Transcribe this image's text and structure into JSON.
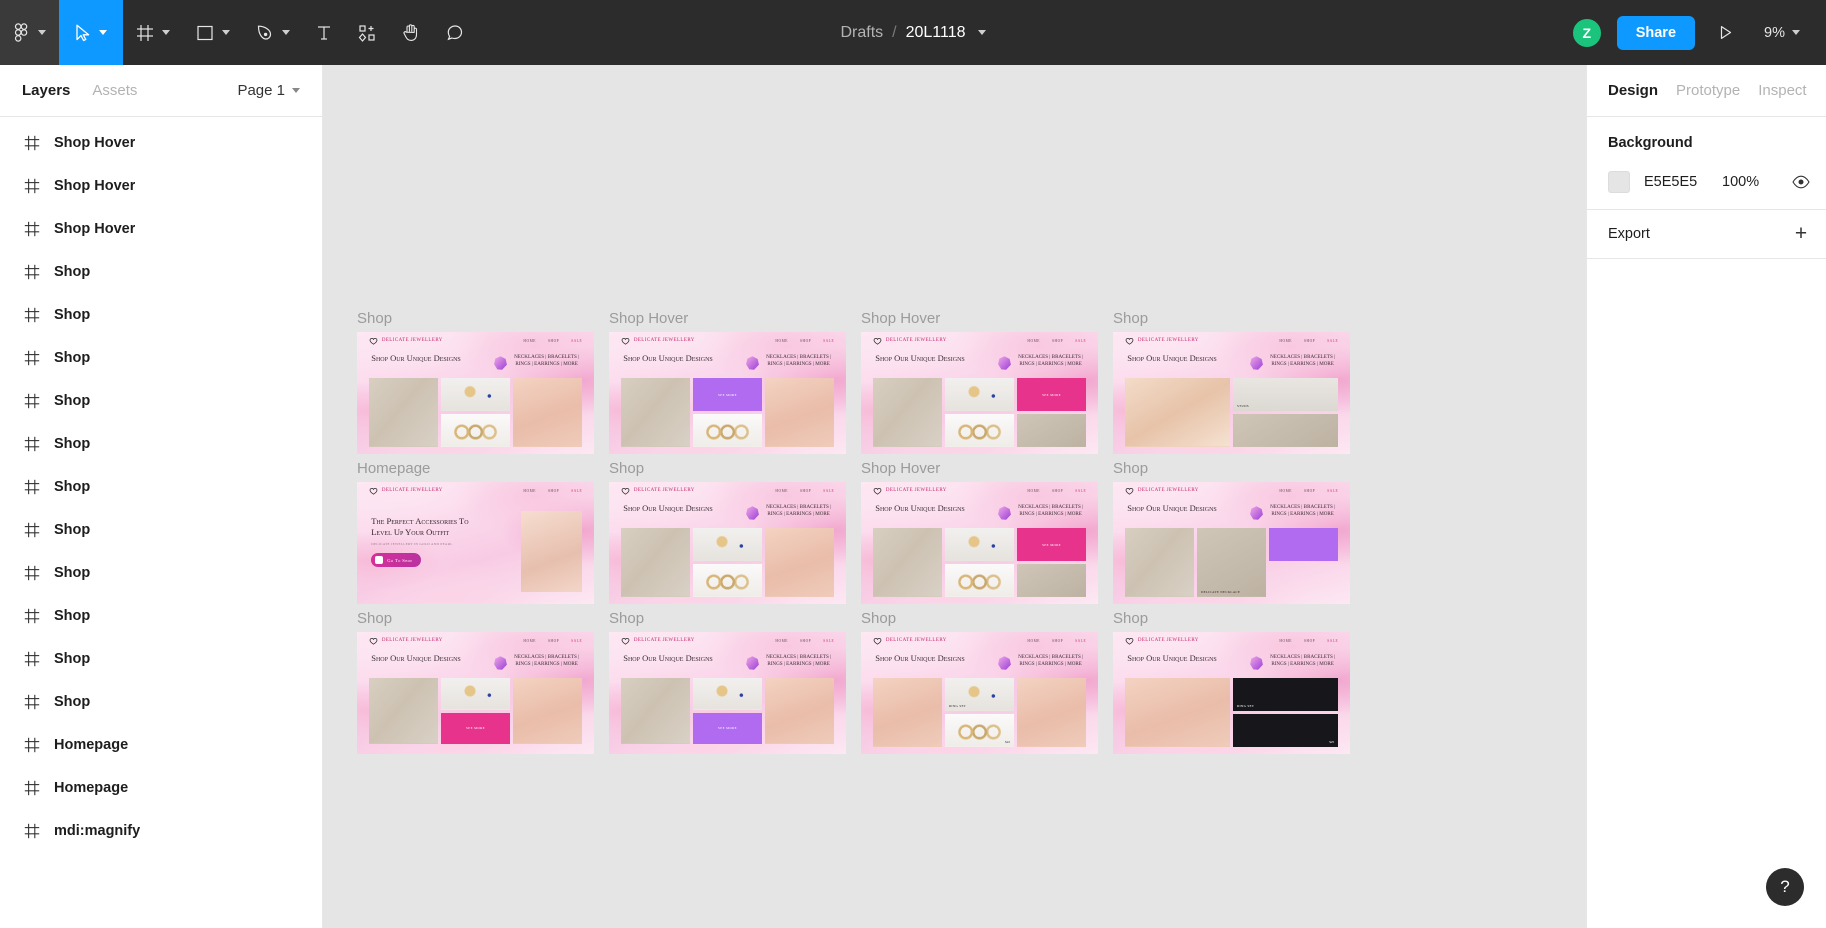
{
  "toolbar": {
    "tools": [
      {
        "name": "figma-menu-icon",
        "label": "Main menu",
        "caret": true,
        "active": false
      },
      {
        "name": "move-tool-icon",
        "label": "Move",
        "caret": true,
        "active": true
      },
      {
        "name": "frame-tool-icon",
        "label": "Frame",
        "caret": true,
        "active": false
      },
      {
        "name": "shape-tool-icon",
        "label": "Rectangle",
        "caret": true,
        "active": false
      },
      {
        "name": "pen-tool-icon",
        "label": "Pen",
        "caret": true,
        "active": false
      },
      {
        "name": "text-tool-icon",
        "label": "Text",
        "caret": false,
        "active": false
      },
      {
        "name": "components-tool-icon",
        "label": "Resources",
        "caret": false,
        "active": false
      },
      {
        "name": "hand-tool-icon",
        "label": "Hand",
        "caret": false,
        "active": false
      },
      {
        "name": "comment-tool-icon",
        "label": "Comment",
        "caret": false,
        "active": false
      }
    ],
    "breadcrumb_project": "Drafts",
    "breadcrumb_sep": "/",
    "breadcrumb_file": "20L1118",
    "avatar_initial": "Z",
    "share_label": "Share",
    "present_icon": "play-icon",
    "zoom_level": "9%"
  },
  "left_panel": {
    "tabs": [
      {
        "label": "Layers",
        "active": true
      },
      {
        "label": "Assets",
        "active": false
      }
    ],
    "page_name": "Page 1",
    "layers": [
      {
        "name": "Shop Hover",
        "icon": "frame-icon"
      },
      {
        "name": "Shop Hover",
        "icon": "frame-icon"
      },
      {
        "name": "Shop Hover",
        "icon": "frame-icon"
      },
      {
        "name": "Shop",
        "icon": "frame-icon"
      },
      {
        "name": "Shop",
        "icon": "frame-icon"
      },
      {
        "name": "Shop",
        "icon": "frame-icon"
      },
      {
        "name": "Shop",
        "icon": "frame-icon"
      },
      {
        "name": "Shop",
        "icon": "frame-icon"
      },
      {
        "name": "Shop",
        "icon": "frame-icon"
      },
      {
        "name": "Shop",
        "icon": "frame-icon"
      },
      {
        "name": "Shop",
        "icon": "frame-icon"
      },
      {
        "name": "Shop",
        "icon": "frame-icon"
      },
      {
        "name": "Shop",
        "icon": "frame-icon"
      },
      {
        "name": "Shop",
        "icon": "frame-icon"
      },
      {
        "name": "Homepage",
        "icon": "frame-icon"
      },
      {
        "name": "Homepage",
        "icon": "frame-icon"
      },
      {
        "name": "mdi:magnify",
        "icon": "frame-icon"
      }
    ]
  },
  "right_panel": {
    "tabs": [
      {
        "label": "Design",
        "active": true
      },
      {
        "label": "Prototype",
        "active": false
      },
      {
        "label": "Inspect",
        "active": false
      }
    ],
    "background": {
      "title": "Background",
      "hex": "E5E5E5",
      "opacity": "100%",
      "visibility_icon": "eye-icon"
    },
    "export": {
      "title": "Export",
      "add_icon": "plus-icon"
    }
  },
  "canvas": {
    "background_color": "#E5E5E5",
    "frames": [
      {
        "label": "Shop",
        "type": "shop",
        "col": 0,
        "row": 0
      },
      {
        "label": "Shop Hover",
        "type": "shop_hover_purple",
        "col": 1,
        "row": 0
      },
      {
        "label": "Shop Hover",
        "type": "shop_hover_pink",
        "col": 2,
        "row": 0
      },
      {
        "label": "Shop",
        "type": "shop_ear",
        "col": 3,
        "row": 0
      },
      {
        "label": "Homepage",
        "type": "homepage",
        "col": 0,
        "row": 1
      },
      {
        "label": "Shop",
        "type": "shop",
        "col": 1,
        "row": 1
      },
      {
        "label": "Shop Hover",
        "type": "shop_hover_pink",
        "col": 2,
        "row": 1
      },
      {
        "label": "Shop",
        "type": "shop_necklace",
        "col": 3,
        "row": 1
      },
      {
        "label": "Shop",
        "type": "shop_hover_pink2",
        "col": 0,
        "row": 2
      },
      {
        "label": "Shop",
        "type": "shop_hover_purple2",
        "col": 1,
        "row": 2
      },
      {
        "label": "Shop",
        "type": "shop_ringset",
        "col": 2,
        "row": 2
      },
      {
        "label": "Shop",
        "type": "shop_dark",
        "col": 3,
        "row": 2
      }
    ]
  },
  "design_content": {
    "brand": "DELICATE JEWELLERY",
    "nav": [
      "HOME",
      "SHOP",
      "SALE"
    ],
    "shop_headline": "Shop Our Unique Designs",
    "categories": "NECKLACES | BRACELETS | RINGS | EARRINGS | MORE",
    "see_more": "SEE MORE",
    "homepage_headline": "The Perfect Accessories To Level Up Your Outfit",
    "homepage_sub": "DELICATE JEWELLERY IN GOLD AND PEARL",
    "homepage_cta": "Go To Shop",
    "product_necklace": "DELICATE NECKLACE",
    "product_studs": "STUDS",
    "product_ringset": "RING SET",
    "price_22": "$22",
    "price_25": "$25"
  },
  "help": {
    "icon": "question-mark-icon",
    "label": "?"
  }
}
